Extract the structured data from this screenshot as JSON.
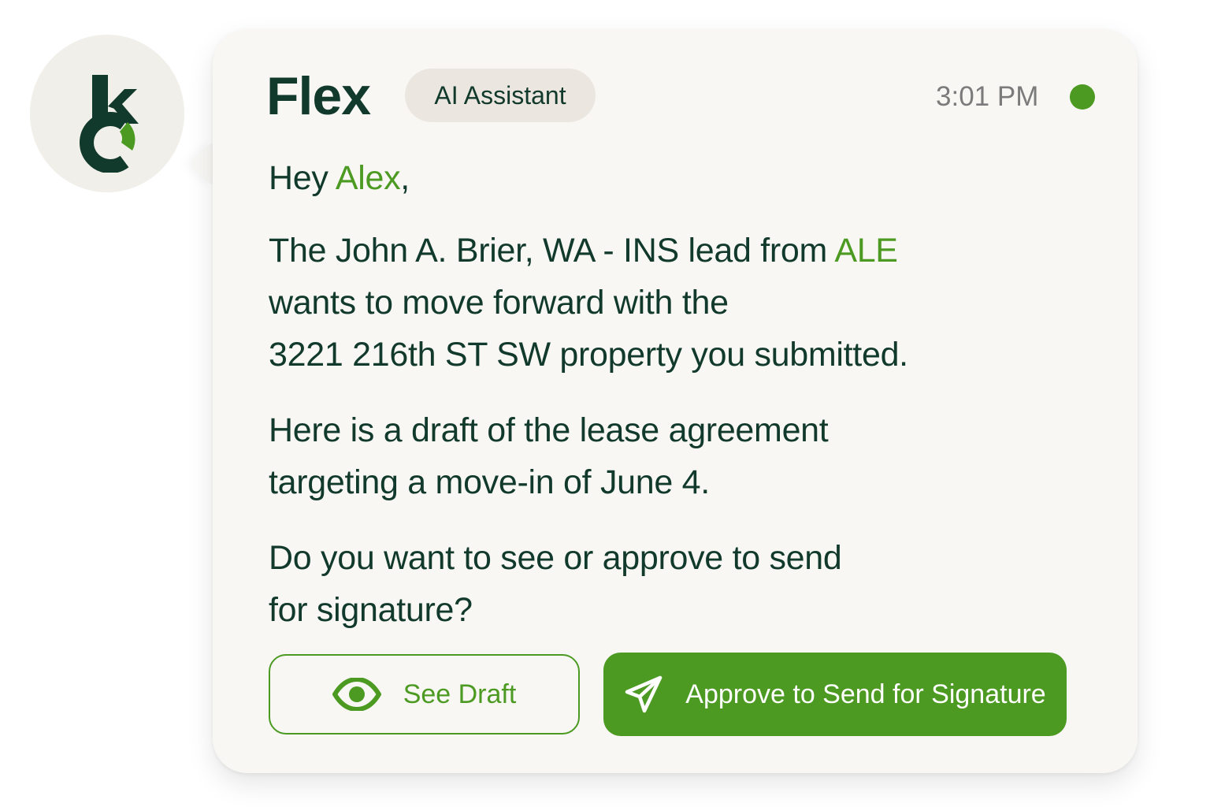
{
  "assistant": {
    "name": "Flex",
    "role_badge": "AI Assistant",
    "time": "3:01 PM",
    "status": "online",
    "avatar_icon": "kc-logo-icon"
  },
  "message": {
    "greeting_prefix": "Hey ",
    "greeting_name": "Alex",
    "greeting_suffix": ",",
    "p1_line1_prefix": "The John A. Brier, WA - INS lead from ",
    "p1_line1_source": "ALE",
    "p1_line2": "wants to move forward with the",
    "p1_line3": "3221 216th ST SW property you submitted.",
    "p2_line1": "Here is a draft of the lease agreement",
    "p2_line2": "targeting a move-in of June 4.",
    "p3_line1": "Do you want to see or approve to send",
    "p3_line2": "for signature?"
  },
  "actions": {
    "see_draft": {
      "label": "See Draft",
      "icon": "eye-icon"
    },
    "approve": {
      "label": "Approve to Send for Signature",
      "icon": "paper-plane-icon"
    }
  },
  "colors": {
    "accent": "#4c9a22",
    "text": "#123a2c",
    "card": "#f8f7f4",
    "badge": "#ebe7e0",
    "muted": "#7b7b7b"
  }
}
